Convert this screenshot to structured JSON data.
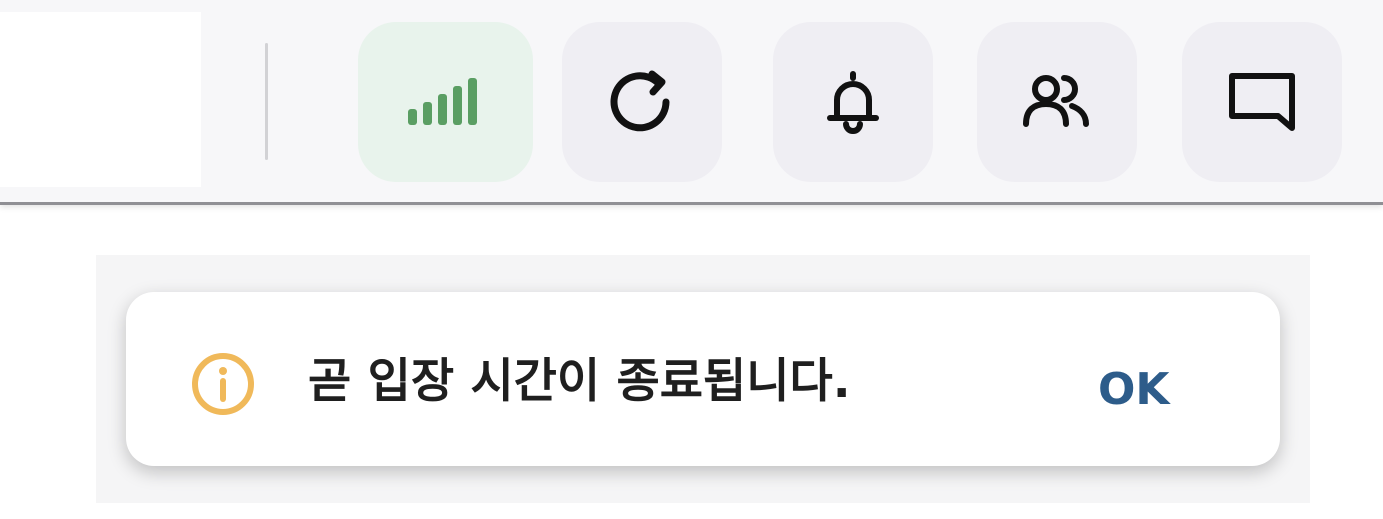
{
  "toolbar": {
    "icons": {
      "signal": "signal-strength-icon",
      "refresh": "refresh-icon",
      "notifications": "bell-icon",
      "participants": "users-icon",
      "chat": "chat-icon"
    },
    "colors": {
      "signal": "#5a9e63",
      "signal_bg": "#e8f3ec",
      "button_bg": "#efeef3",
      "icon": "#111111"
    }
  },
  "toast": {
    "message": "곧 입장 시간이 종료됩니다.",
    "action_label": "OK",
    "icon": "info-icon",
    "colors": {
      "icon": "#f0b95a",
      "action": "#2d5c8a",
      "text": "#1f1f1f"
    }
  }
}
